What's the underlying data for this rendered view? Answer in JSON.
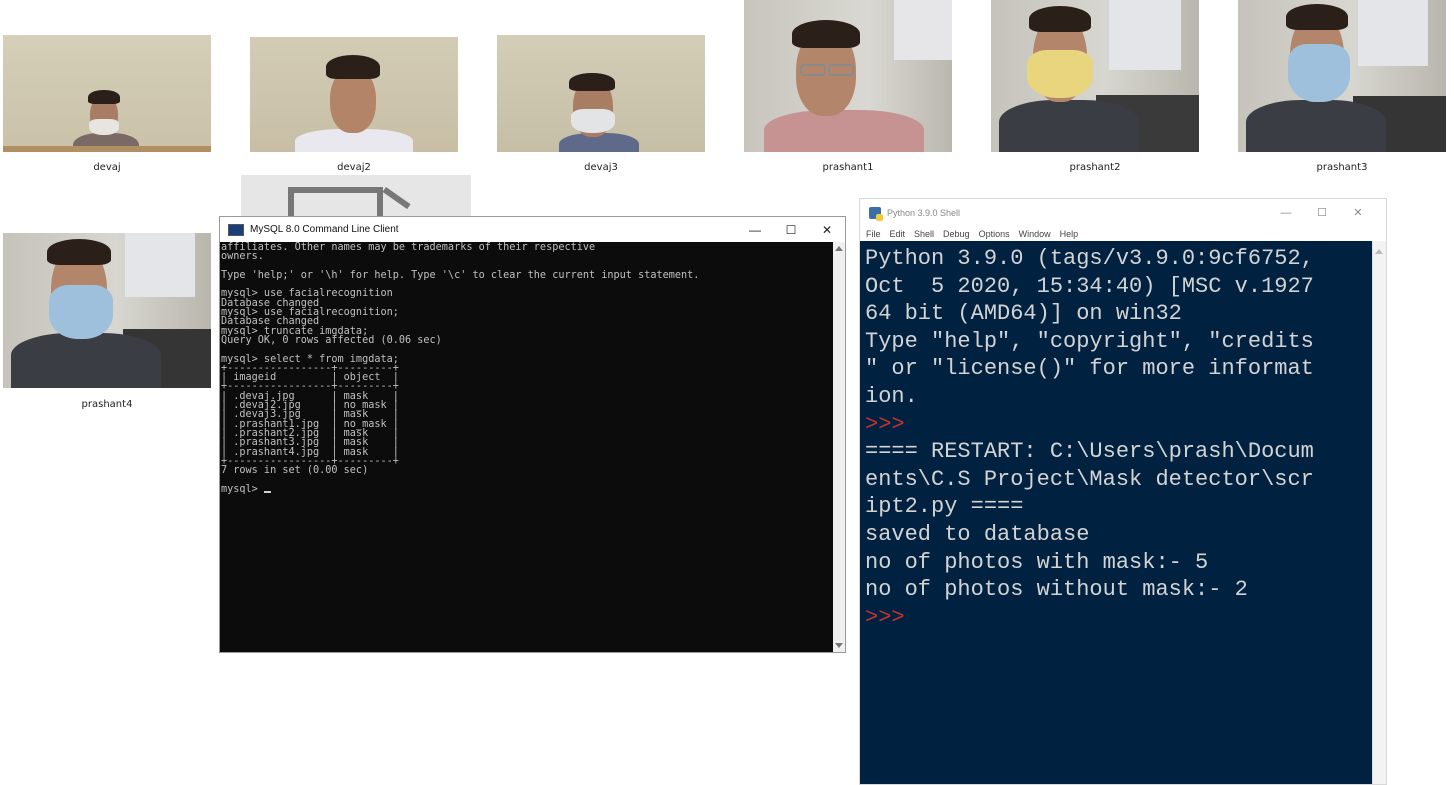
{
  "thumbnails": [
    {
      "label": "devaj",
      "mask": "white"
    },
    {
      "label": "devaj2",
      "mask": "none"
    },
    {
      "label": "devaj3",
      "mask": "white"
    },
    {
      "label": "prashant1",
      "mask": "none"
    },
    {
      "label": "prashant2",
      "mask": "yellow"
    },
    {
      "label": "prashant3",
      "mask": "blue"
    },
    {
      "label": "prashant4",
      "mask": "blue"
    }
  ],
  "mysql": {
    "title": "MySQL 8.0 Command Line Client",
    "controls": {
      "minimize": "—",
      "maximize": "☐",
      "close": "✕"
    },
    "lines": [
      "affiliates. Other names may be trademarks of their respective",
      "owners.",
      "",
      "Type 'help;' or '\\h' for help. Type '\\c' to clear the current input statement.",
      "",
      "mysql> use facialrecognition",
      "Database changed",
      "mysql> use facialrecognition;",
      "Database changed",
      "mysql> truncate imgdata;",
      "Query OK, 0 rows affected (0.06 sec)",
      "",
      "mysql> select * from imgdata;",
      "+-----------------+---------+",
      "| imageid         | object  |",
      "+-----------------+---------+",
      "| .devaj.jpg      | mask    |",
      "| .devaj2.jpg     | no_mask |",
      "| .devaj3.jpg     | mask    |",
      "| .prashant1.jpg  | no_mask |",
      "| .prashant2.jpg  | mask    |",
      "| .prashant3.jpg  | mask    |",
      "| .prashant4.jpg  | mask    |",
      "+-----------------+---------+",
      "7 rows in set (0.00 sec)",
      ""
    ],
    "prompt": "mysql> "
  },
  "python": {
    "title": "Python 3.9.0 Shell",
    "controls": {
      "minimize": "—",
      "maximize": "☐",
      "close": "✕"
    },
    "menu": [
      "File",
      "Edit",
      "Shell",
      "Debug",
      "Options",
      "Window",
      "Help"
    ],
    "lines": [
      {
        "text": "Python 3.9.0 (tags/v3.9.0:9cf6752,",
        "prompt": false
      },
      {
        "text": "Oct  5 2020, 15:34:40) [MSC v.1927",
        "prompt": false
      },
      {
        "text": "64 bit (AMD64)] on win32",
        "prompt": false
      },
      {
        "text": "Type \"help\", \"copyright\", \"credits",
        "prompt": false
      },
      {
        "text": "\" or \"license()\" for more informat",
        "prompt": false
      },
      {
        "text": "ion.",
        "prompt": false
      },
      {
        "text": ">>>",
        "prompt": true
      },
      {
        "text": "==== RESTART: C:\\Users\\prash\\Docum",
        "prompt": false
      },
      {
        "text": "ents\\C.S Project\\Mask detector\\scr",
        "prompt": false
      },
      {
        "text": "ipt2.py ====",
        "prompt": false
      },
      {
        "text": "saved to database",
        "prompt": false
      },
      {
        "text": "no of photos with mask:- 5",
        "prompt": false
      },
      {
        "text": "no of photos without mask:- 2",
        "prompt": false
      },
      {
        "text": ">>>",
        "prompt": true
      }
    ]
  },
  "colors": {
    "console_bg": "#0c0c0c",
    "console_fg": "#c0c0c0",
    "idle_bg": "#002240",
    "idle_fg": "#d3d3d3",
    "idle_prompt": "#c5312f"
  }
}
